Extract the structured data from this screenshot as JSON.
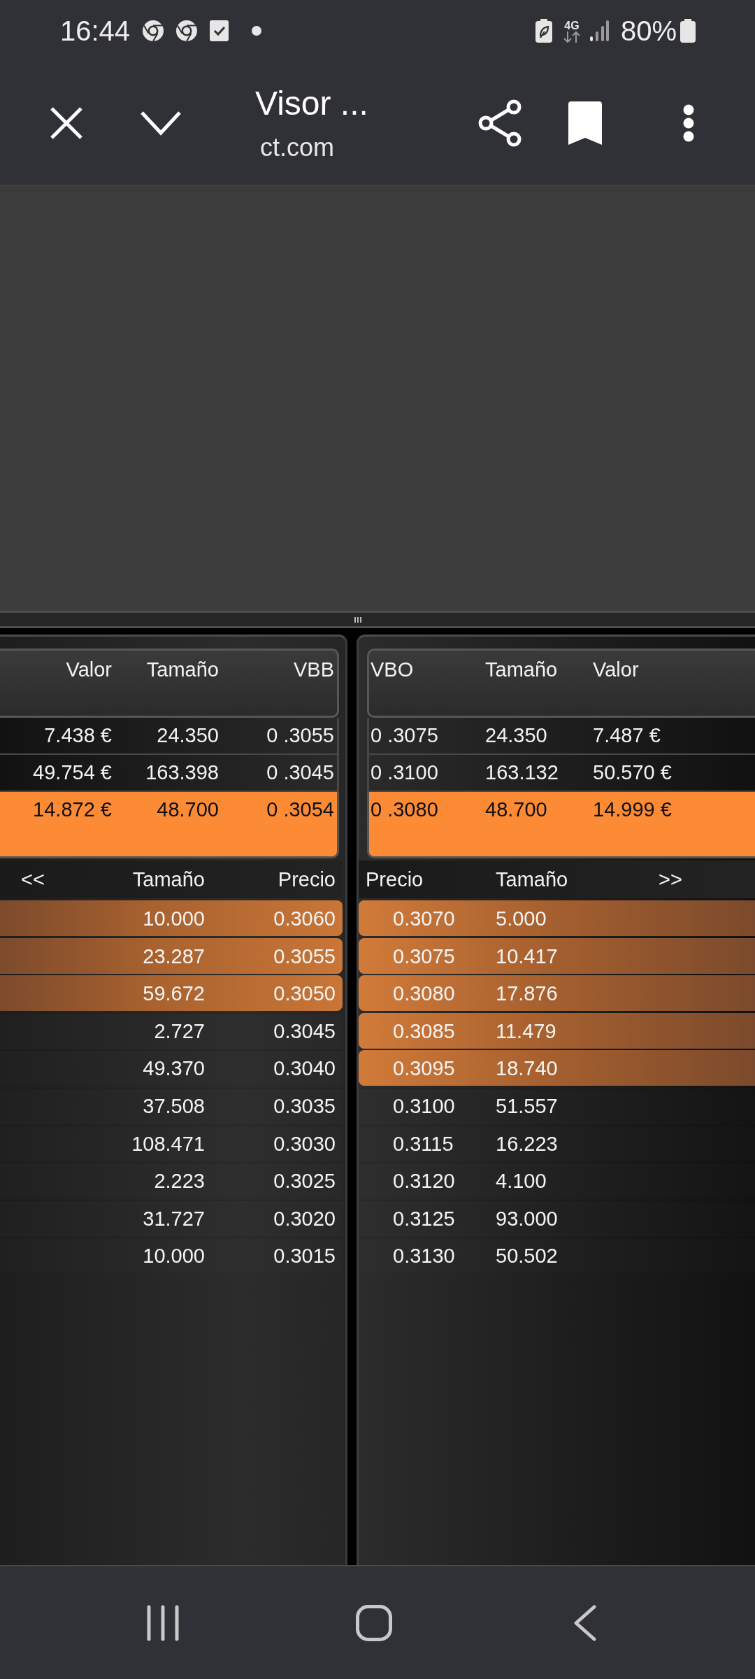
{
  "status_bar": {
    "time": "16:44",
    "network_type": "4G",
    "battery": "80%"
  },
  "toolbar": {
    "title": "Visor ...",
    "url": "ct.com"
  },
  "bid_summary": {
    "columns": [
      "Valor",
      "Tamaño",
      "VBB"
    ],
    "rows": [
      {
        "cells": [
          "7.438 €",
          "24.350",
          "0 .3055"
        ],
        "highlighted": false
      },
      {
        "cells": [
          "49.754 €",
          "163.398",
          "0 .3045"
        ],
        "highlighted": false
      },
      {
        "cells": [
          "14.872 €",
          "48.700",
          "0 .3054"
        ],
        "highlighted": true
      }
    ]
  },
  "ask_summary": {
    "columns": [
      "VBO",
      "Tamaño",
      "Valor"
    ],
    "rows": [
      {
        "cells": [
          "0 .3075",
          "24.350",
          "7.487 €"
        ],
        "highlighted": false
      },
      {
        "cells": [
          "0 .3100",
          "163.132",
          "50.570 €"
        ],
        "highlighted": false
      },
      {
        "cells": [
          "0 .3080",
          "48.700",
          "14.999 €"
        ],
        "highlighted": true
      }
    ]
  },
  "bid_book": {
    "nav_button": "<<",
    "columns": [
      "Tamaño",
      "Precio"
    ],
    "rows": [
      {
        "size": "10.000",
        "price": "0.3060",
        "highlighted": true
      },
      {
        "size": "23.287",
        "price": "0.3055",
        "highlighted": true
      },
      {
        "size": "59.672",
        "price": "0.3050",
        "highlighted": true
      },
      {
        "size": "2.727",
        "price": "0.3045",
        "highlighted": false
      },
      {
        "size": "49.370",
        "price": "0.3040",
        "highlighted": false
      },
      {
        "size": "37.508",
        "price": "0.3035",
        "highlighted": false
      },
      {
        "size": "108.471",
        "price": "0.3030",
        "highlighted": false
      },
      {
        "size": "2.223",
        "price": "0.3025",
        "highlighted": false
      },
      {
        "size": "31.727",
        "price": "0.3020",
        "highlighted": false
      },
      {
        "size": "10.000",
        "price": "0.3015",
        "highlighted": false
      }
    ]
  },
  "ask_book": {
    "columns": [
      "Precio",
      "Tamaño"
    ],
    "nav_button": ">>",
    "rows": [
      {
        "price": "0.3070",
        "size": "5.000",
        "highlighted": true
      },
      {
        "price": "0.3075",
        "size": "10.417",
        "highlighted": true
      },
      {
        "price": "0.3080",
        "size": "17.876",
        "highlighted": true
      },
      {
        "price": "0.3085",
        "size": "11.479",
        "highlighted": true
      },
      {
        "price": "0.3095",
        "size": "18.740",
        "highlighted": true
      },
      {
        "price": "0.3100",
        "size": "51.557",
        "highlighted": false
      },
      {
        "price": "0.3115",
        "size": "16.223",
        "highlighted": false
      },
      {
        "price": "0.3120",
        "size": "4.100",
        "highlighted": false
      },
      {
        "price": "0.3125",
        "size": "93.000",
        "highlighted": false
      },
      {
        "price": "0.3130",
        "size": "50.502",
        "highlighted": false
      }
    ]
  }
}
